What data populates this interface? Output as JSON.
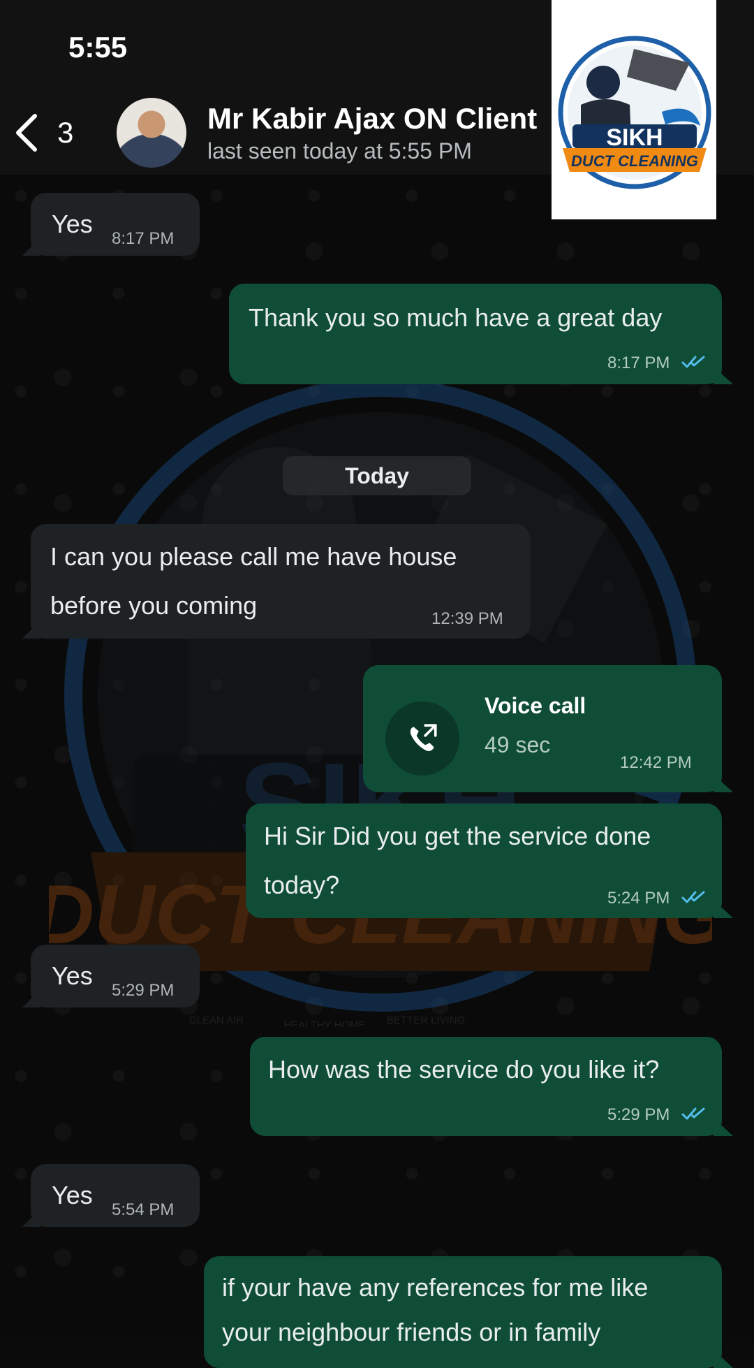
{
  "status_bar": {
    "time": "5:55"
  },
  "header": {
    "back_count": "3",
    "contact_name": "Mr Kabir Ajax ON Client",
    "last_seen": "last seen today at 5:55 PM"
  },
  "logo": {
    "line1": "SIKH",
    "line2": "DUCT CLEANING"
  },
  "watermark": {
    "line1": "SIKH",
    "line2": "DUCT CLEANING",
    "badges": [
      "CLEAN AIR",
      "HEALTHY HOME",
      "BETTER LIVING"
    ]
  },
  "date_divider": "Today",
  "messages": [
    {
      "direction": "incoming",
      "text": "Yes",
      "time": "8:17 PM"
    },
    {
      "direction": "outgoing",
      "text": "Thank you so much have a great day",
      "time": "8:17 PM",
      "read": true
    },
    {
      "direction": "incoming",
      "lines": [
        "I can you  please call me have house",
        "before you coming"
      ],
      "time": "12:39 PM"
    },
    {
      "direction": "outgoing",
      "type": "voice_call",
      "title": "Voice call",
      "duration": "49 sec",
      "time": "12:42 PM"
    },
    {
      "direction": "outgoing",
      "lines": [
        "Hi Sir Did you get the service done",
        "today?"
      ],
      "time": "5:24 PM",
      "read": true
    },
    {
      "direction": "incoming",
      "text": "Yes",
      "time": "5:29 PM"
    },
    {
      "direction": "outgoing",
      "text": "How was the service do you like it?",
      "time": "5:29 PM",
      "read": true
    },
    {
      "direction": "incoming",
      "text": "Yes",
      "time": "5:54 PM"
    },
    {
      "direction": "outgoing",
      "lines": [
        "if your have any references for me like",
        "your neighbour friends  or in family"
      ]
    }
  ],
  "colors": {
    "incoming_bubble": "#1f2224",
    "outgoing_bubble": "#0f4d36",
    "read_ticks": "#53bdeb",
    "background": "#0b0b0b"
  }
}
